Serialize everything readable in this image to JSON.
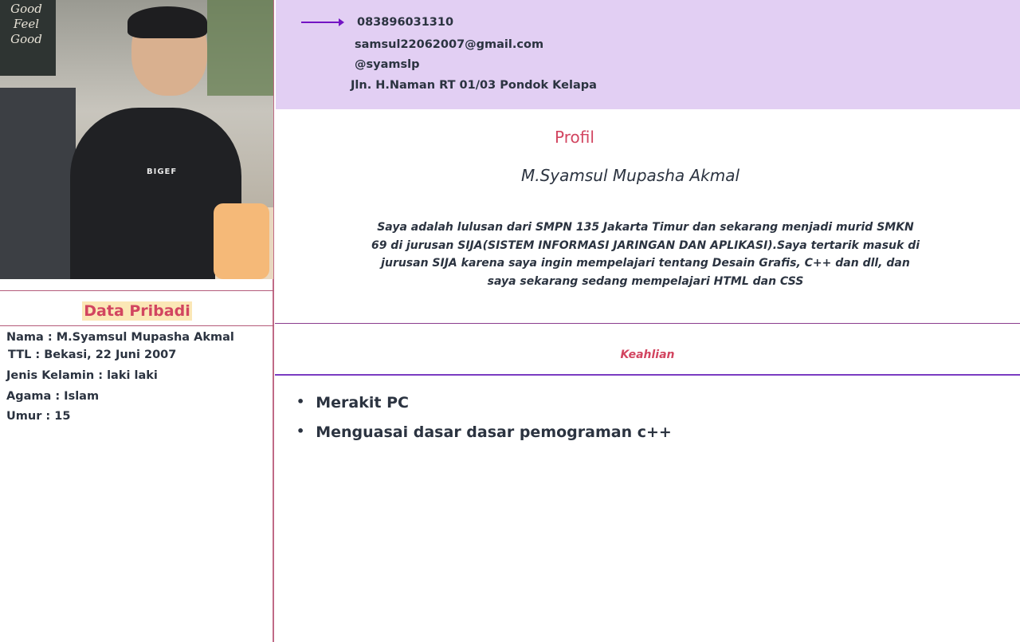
{
  "contact": {
    "phone": "083896031310",
    "email": "samsul22062007@gmail.com",
    "social": "@syamslp",
    "address": "Jln. H.Naman RT 01/03 Pondok Kelapa",
    "arrow_color": "#7314c4"
  },
  "photo": {
    "sign_text": "Good Feel Good",
    "shirt_text": "BIGEF"
  },
  "personal": {
    "title": "Data Pribadi",
    "items": [
      "Nama : M.Syamsul Mupasha Akmal",
      "TTL : Bekasi, 22 Juni 2007",
      "Jenis Kelamin : laki laki",
      "Agama : Islam",
      "Umur : 15"
    ]
  },
  "profile": {
    "title": "Profil",
    "name": "M.Syamsul Mupasha Akmal",
    "description": "Saya adalah lulusan dari SMPN 135 Jakarta Timur dan sekarang menjadi murid  SMKN 69 di jurusan SIJA(SISTEM INFORMASI JARINGAN DAN APLIKASI).Saya tertarik masuk di jurusan SIJA karena saya ingin mempelajari tentang Desain Grafis, C++ dan dll, dan  saya sekarang sedang mempelajari HTML dan CSS"
  },
  "skills": {
    "title": "Keahlian",
    "items": [
      "Merakit PC",
      "Menguasai dasar dasar pemograman c++"
    ]
  },
  "colors": {
    "accent": "#d24560",
    "header_bg": "#e2cff3",
    "text": "#2b3340"
  }
}
